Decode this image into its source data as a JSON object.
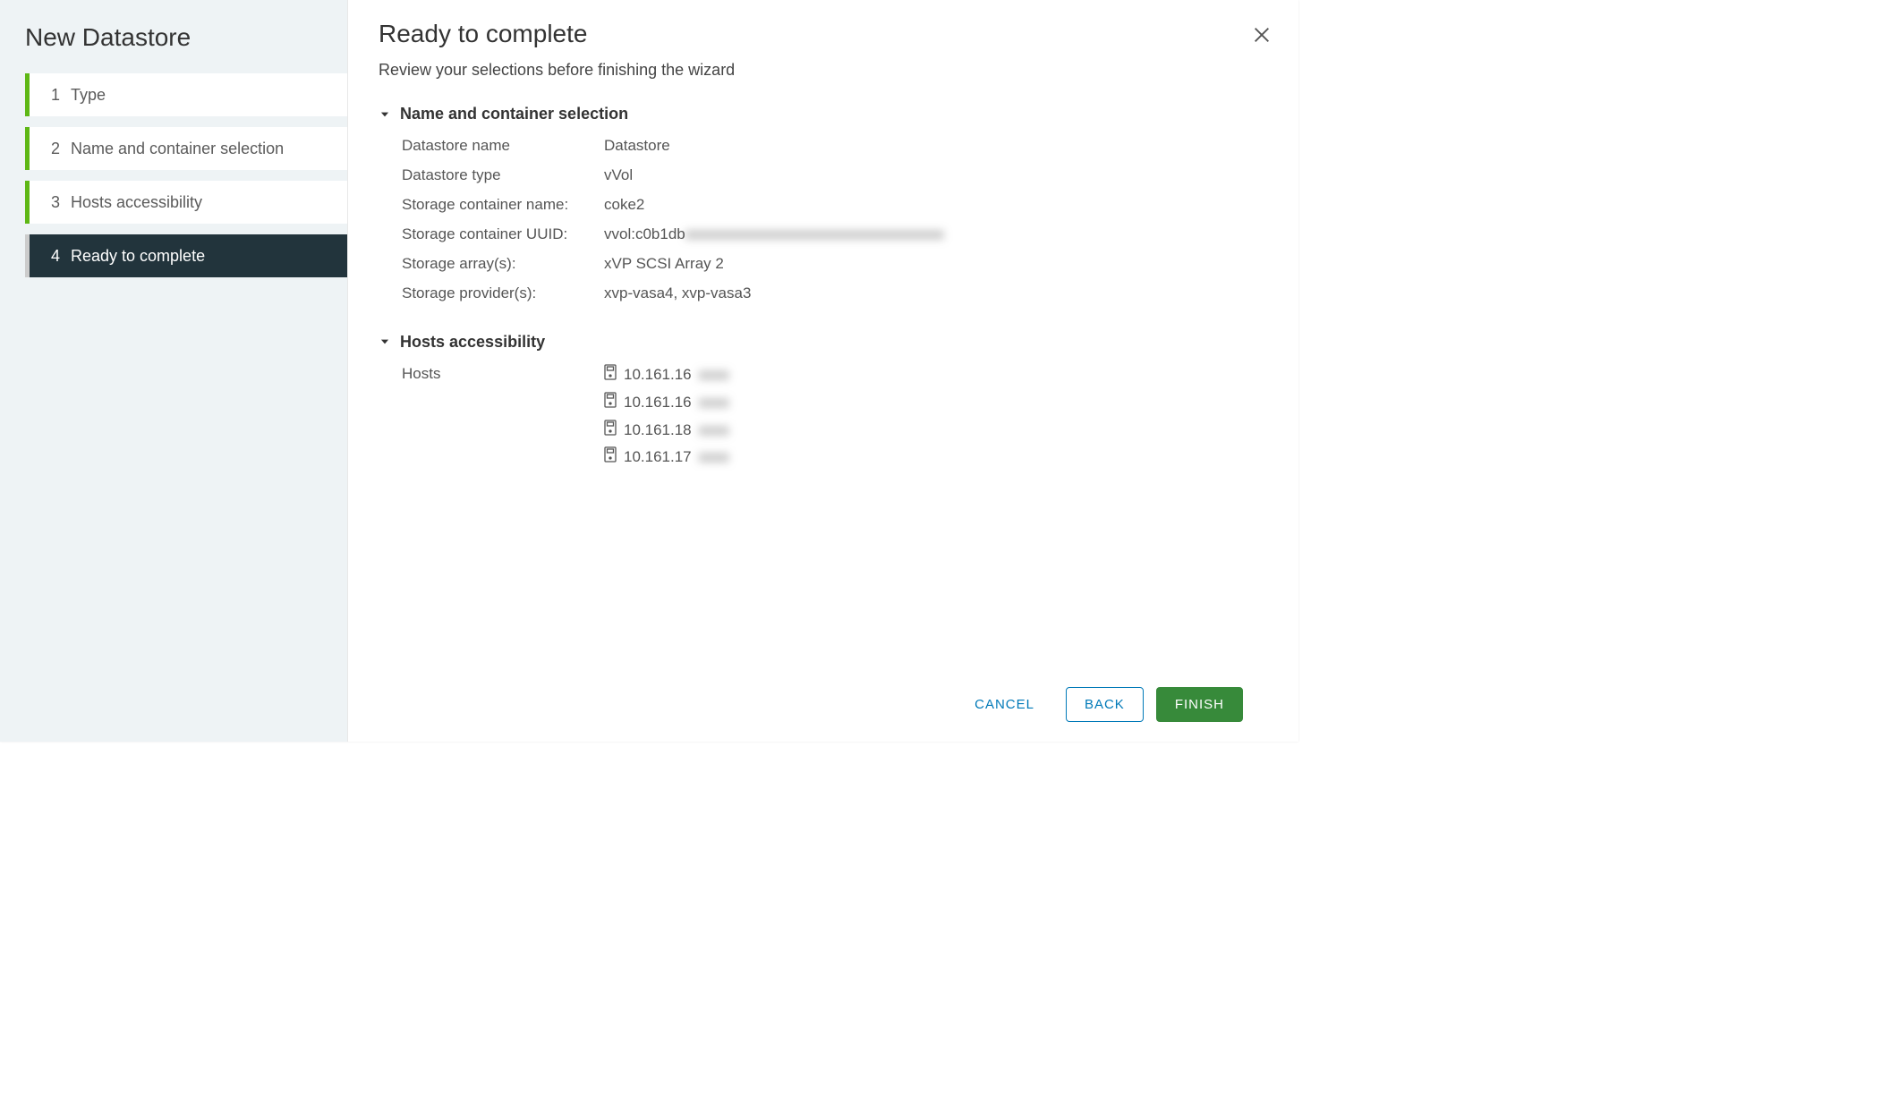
{
  "sidebar": {
    "title": "New Datastore",
    "steps": [
      {
        "num": "1",
        "label": "Type"
      },
      {
        "num": "2",
        "label": "Name and container selection"
      },
      {
        "num": "3",
        "label": "Hosts accessibility"
      },
      {
        "num": "4",
        "label": "Ready to complete"
      }
    ]
  },
  "main": {
    "title": "Ready to complete",
    "subtitle": "Review your selections before finishing the wizard",
    "sections": {
      "nameContainer": {
        "header": "Name and container selection",
        "rows": {
          "datastoreName": {
            "label": "Datastore name",
            "value": "Datastore"
          },
          "datastoreType": {
            "label": "Datastore type",
            "value": "vVol"
          },
          "containerName": {
            "label": "Storage container name:",
            "value": "coke2"
          },
          "containerUuid": {
            "label": "Storage container UUID:",
            "value": "vvol:c0b1db",
            "masked": "xxxxxxxxxxxxxxxxxxxxxxxxxxxxxxxxxx"
          },
          "arrays": {
            "label": "Storage array(s):",
            "value": "xVP SCSI Array 2"
          },
          "providers": {
            "label": "Storage provider(s):",
            "value": "xvp-vasa4, xvp-vasa3"
          }
        }
      },
      "hostsAccess": {
        "header": "Hosts accessibility",
        "label": "Hosts",
        "hosts": [
          {
            "ip": "10.161.16",
            "suffix": "xxxx"
          },
          {
            "ip": "10.161.16",
            "suffix": "xxxx"
          },
          {
            "ip": "10.161.18",
            "suffix": "xxxx"
          },
          {
            "ip": "10.161.17",
            "suffix": "xxxx"
          }
        ]
      }
    }
  },
  "footer": {
    "cancel": "CANCEL",
    "back": "BACK",
    "finish": "FINISH"
  }
}
